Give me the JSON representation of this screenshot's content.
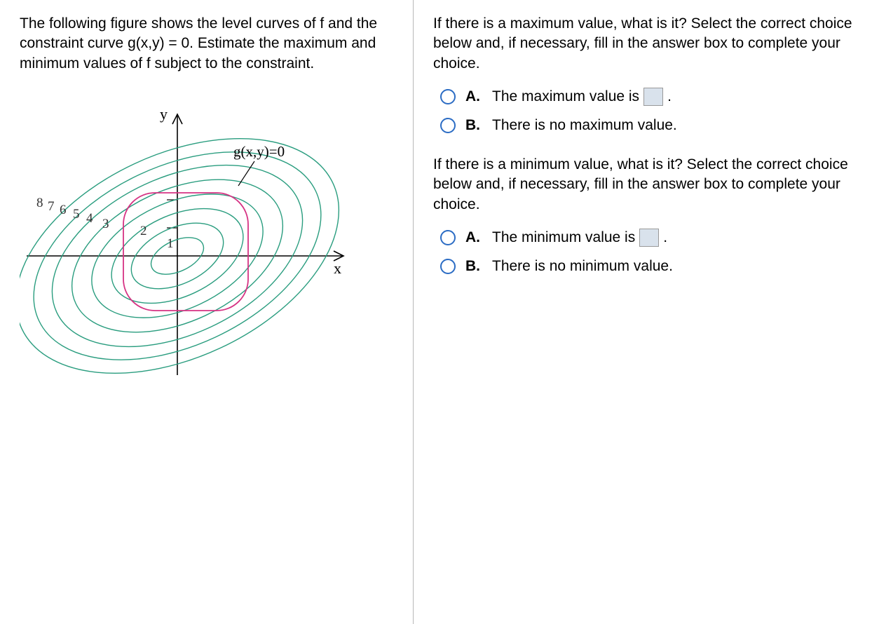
{
  "left": {
    "prompt": "The following figure shows the level curves of f and the constraint curve g(x,y) = 0. Estimate the maximum and minimum values of f subject to the constraint.",
    "figure": {
      "y_axis_label": "y",
      "x_axis_label": "x",
      "constraint_label": "g(x,y)=0",
      "level_values": [
        "8",
        "7",
        "6",
        "5",
        "4",
        "3",
        "2",
        "1"
      ]
    }
  },
  "right": {
    "q1": {
      "prompt": "If there is a maximum value, what is it? Select the correct choice below and, if necessary, fill in the answer box to complete your choice.",
      "options": {
        "A": {
          "letter": "A.",
          "pre": "The maximum value is",
          "post": "."
        },
        "B": {
          "letter": "B.",
          "text": "There is no maximum value."
        }
      }
    },
    "q2": {
      "prompt": "If there is a minimum value, what is it? Select the correct choice below and, if necessary, fill in the answer box to complete your choice.",
      "options": {
        "A": {
          "letter": "A.",
          "pre": "The minimum value is",
          "post": "."
        },
        "B": {
          "letter": "B.",
          "text": "There is no minimum value."
        }
      }
    }
  }
}
